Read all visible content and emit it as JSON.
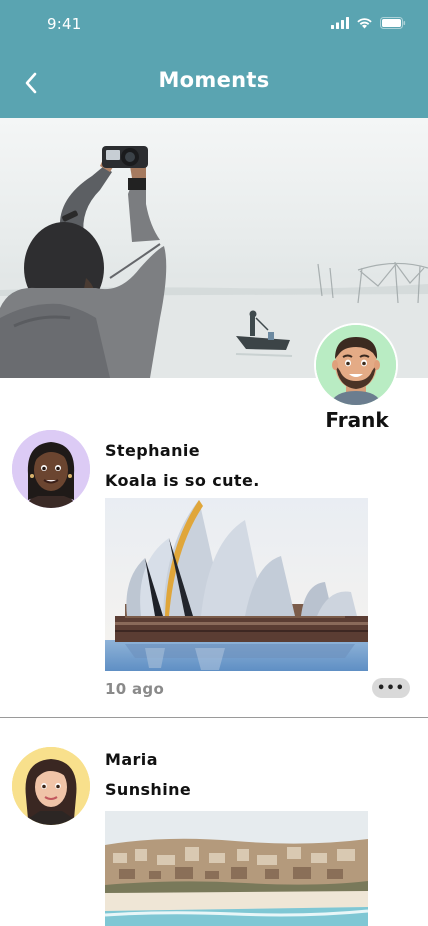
{
  "status_bar": {
    "time": "9:41"
  },
  "header": {
    "title": "Moments"
  },
  "profile": {
    "name": "Frank"
  },
  "posts": [
    {
      "author": "Stephanie",
      "text": "Koala is so cute.",
      "time": "10 ago",
      "more_label": "•••"
    },
    {
      "author": "Maria",
      "text": "Sunshine"
    }
  ],
  "colors": {
    "header_bg": "#5aa4b1",
    "profile_avatar_bg": "#b9ecc3",
    "avatar1_bg": "#dccbf5",
    "avatar2_bg": "#f8e08c"
  },
  "icons": [
    "back-chevron-icon",
    "cellular-signal-icon",
    "wifi-icon",
    "battery-icon",
    "more-dots-icon"
  ]
}
